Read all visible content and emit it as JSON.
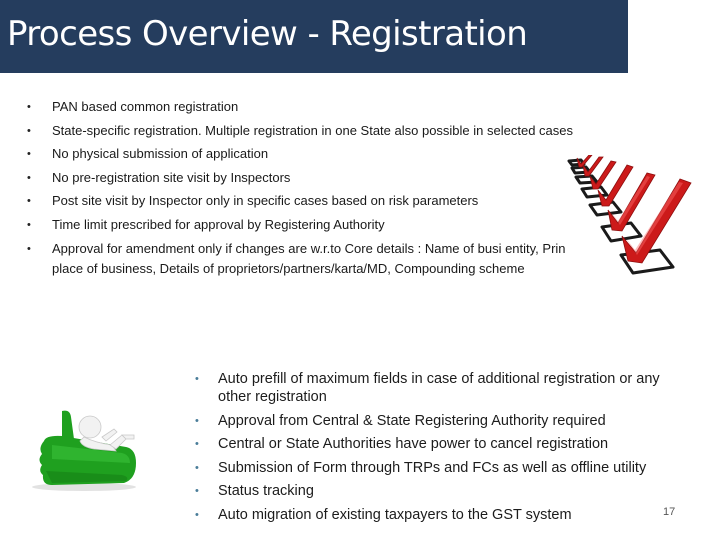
{
  "slide": {
    "title": "Process Overview - Registration",
    "page_number": "17",
    "colors": {
      "title_bar": "#253d5e",
      "title_text": "#ffffff",
      "bullet_top": "#222222",
      "bullet_bottom": "#4a7d99",
      "checkmark": "#cc1a1a",
      "thumbs_up": "#1fa01f"
    }
  },
  "top_bullets": {
    "bullet_glyph": "•",
    "items": [
      {
        "text": "PAN based common registration"
      },
      {
        "text": "State-specific registration. Multiple registration in one State also possible in selected cases"
      },
      {
        "text": "No physical submission of application"
      },
      {
        "text": "No pre-registration site visit by Inspectors"
      },
      {
        "text": "Post site visit by Inspector only in specific cases based on risk parameters"
      },
      {
        "text": "Time limit prescribed for approval by Registering Authority"
      },
      {
        "text": "Approval for amendment only if changes are w.r.to Core details : Name of busi entity, Principal place of business, Details of proprietors/partners/karta/MD, Compounding scheme"
      }
    ]
  },
  "bottom_bullets": {
    "bullet_glyph": "•",
    "items": [
      {
        "text": "Auto prefill of maximum fields in case of additional registration or any other registration"
      },
      {
        "text": "Approval from Central & State Registering Authority required"
      },
      {
        "text": "Central or State Authorities have power to cancel registration"
      },
      {
        "text": "Submission of Form through TRPs and FCs as well as offline utility"
      },
      {
        "text": "Status tracking"
      },
      {
        "text": "Auto migration of existing taxpayers to the GST system"
      }
    ]
  },
  "images": {
    "checklist": "checklist-checkmarks-icon",
    "thumbs_up": "thumbs-up-figure-icon"
  }
}
